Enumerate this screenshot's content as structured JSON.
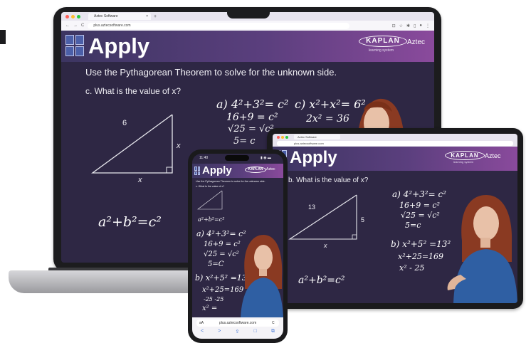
{
  "browser": {
    "tab_title": "Aztec Software",
    "tab_close": "×",
    "new_tab": "+",
    "url": "plus.aztecsoftware.com",
    "nav_back": "←",
    "nav_forward": "→",
    "nav_reload": "C",
    "dot_colors": [
      "#ff5f57",
      "#febc2e",
      "#28c840"
    ]
  },
  "slide": {
    "heading": "Apply",
    "brand": "KAPLAN",
    "partner": "Aztec",
    "brand_tagline": "learning system",
    "instruction": "Use the Pythagorean Theorem to solve for the unknown side.",
    "question_c": "c.  What is the value of x?",
    "question_b": "b.  What is the value of x?",
    "triangle_c": {
      "leg_top": "6",
      "hyp": "x",
      "base": "x"
    },
    "triangle_b": {
      "hyp": "13",
      "leg": "5",
      "base": "x"
    },
    "formula": "a²+b²=c²",
    "laptop_work_a": [
      "a) 4²+3²= c²",
      "16+9 = c²",
      "√25 = √c²",
      "5= c"
    ],
    "laptop_work_c": [
      "c) x²+x²= 6²",
      "2x² = 36"
    ],
    "tablet_work_a": [
      "a) 4²+3²= c²",
      "16+9 = c²",
      "√25 = √c²",
      "5=c"
    ],
    "tablet_work_b": [
      "b) x²+5² =13²",
      "x²+25=169",
      "x² - 25"
    ]
  },
  "phone": {
    "status_time": "11:40",
    "status_icons": "▮ ◉ ▬",
    "url_label": "aA",
    "url": "plus.aztecsoftware.com",
    "reload": "C",
    "bottom_nav": [
      "<",
      ">",
      "⇪",
      "□",
      "⧉"
    ],
    "work": [
      "a) 4²+3²= c²",
      "16+9 = c²",
      "√25 = √c²",
      "5=C",
      "b) x²+5² =13²",
      "x²+25=169",
      "-25  -25",
      "x² ="
    ]
  },
  "colors": {
    "slide_bg": "#2e2744",
    "banner_left": "#3c3561",
    "banner_right": "#8a4a9c",
    "chalk": "#ffffff",
    "presenter_shirt": "#2f5fa3",
    "presenter_hair": "#8a3a22"
  }
}
